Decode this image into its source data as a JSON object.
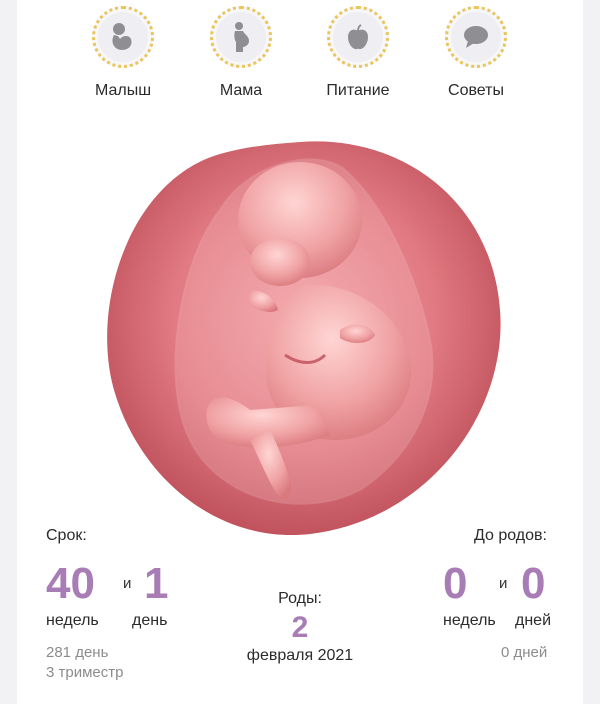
{
  "nav": {
    "items": [
      {
        "label": "Малыш",
        "icon": "baby-icon"
      },
      {
        "label": "Мама",
        "icon": "pregnant-woman-icon"
      },
      {
        "label": "Питание",
        "icon": "apple-icon"
      },
      {
        "label": "Советы",
        "icon": "speech-bubble-icon"
      }
    ]
  },
  "illustration": {
    "icon": "fetus-in-womb-image"
  },
  "term": {
    "label": "Срок:",
    "weeks": "40",
    "and": "и",
    "days": "1",
    "weeks_unit": "недель",
    "days_unit": "день",
    "total_days": "281 день",
    "trimester": "3 триместр"
  },
  "due": {
    "label": "Роды:",
    "day": "2",
    "month_year": "февраля 2021"
  },
  "until": {
    "label": "До родов:",
    "weeks": "0",
    "and": "и",
    "days": "0",
    "weeks_unit": "недель",
    "days_unit": "дней",
    "total_days": "0 дней"
  },
  "colors": {
    "accent": "#a87cb5",
    "dotted_ring": "#e8c65a",
    "icon_gray": "#8e8e93"
  }
}
